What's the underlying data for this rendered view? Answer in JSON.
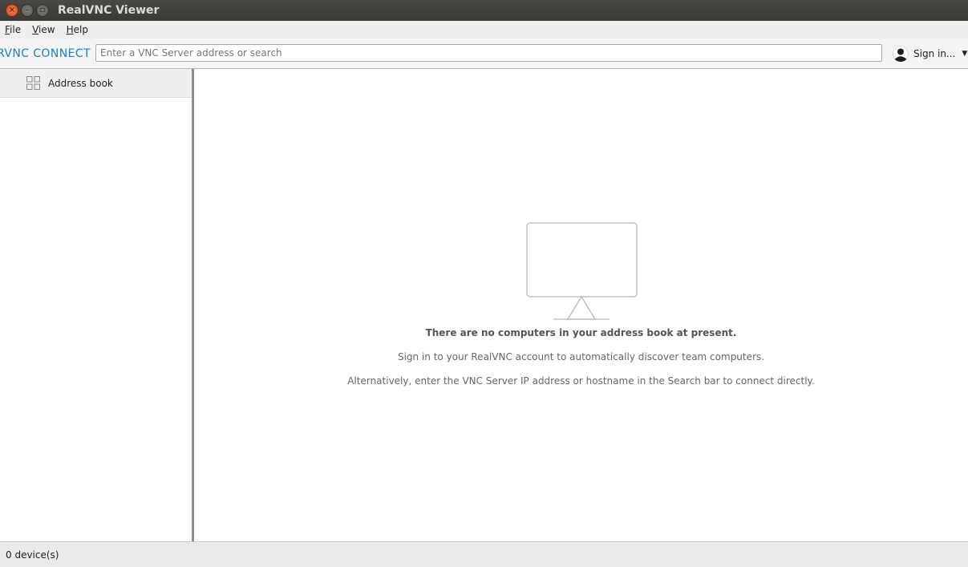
{
  "window": {
    "title": "RealVNC Viewer",
    "close_glyph": "×",
    "min_glyph": "–",
    "max_glyph": "▫"
  },
  "menu": {
    "items": [
      {
        "label": "File"
      },
      {
        "label": "View"
      },
      {
        "label": "Help"
      }
    ]
  },
  "toolbar": {
    "logo": "RVNC CONNECT",
    "search_placeholder": "Enter a VNC Server address or search",
    "search_value": "",
    "signin_label": "Sign in...",
    "caret": "▼",
    "avatar_icon": "user-avatar-icon"
  },
  "sidebar": {
    "items": [
      {
        "label": "Address book",
        "icon": "grid-icon"
      }
    ]
  },
  "main": {
    "empty_icon": "monitor-icon",
    "heading": "There are no computers in your address book at present.",
    "line1": "Sign in to your RealVNC account to automatically discover team computers.",
    "line2": "Alternatively, enter the VNC Server IP address or hostname in the Search bar to connect directly."
  },
  "status": {
    "text": "0 device(s)"
  },
  "colors": {
    "accent": "#1a7fd1",
    "titlebar": "#3b3a36",
    "close_button": "#de4b1c"
  }
}
